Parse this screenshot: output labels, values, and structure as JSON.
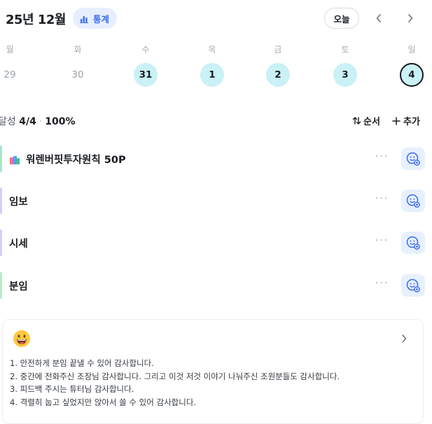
{
  "header": {
    "month_title": "25년 12월",
    "stats_label": "통계",
    "today_label": "오늘",
    "prev_icon": "chevron-left-icon",
    "next_icon": "chevron-right-icon"
  },
  "week": {
    "weekdays": [
      "월",
      "화",
      "수",
      "목",
      "금",
      "토",
      "일"
    ],
    "dates": [
      {
        "day": "29",
        "state": "plain"
      },
      {
        "day": "30",
        "state": "plain"
      },
      {
        "day": "31",
        "state": "done"
      },
      {
        "day": "1",
        "state": "done"
      },
      {
        "day": "2",
        "state": "done"
      },
      {
        "day": "3",
        "state": "done"
      },
      {
        "day": "4",
        "state": "selected"
      }
    ]
  },
  "progress": {
    "label": "달성",
    "count": "4/4",
    "percent": "100%",
    "sort_label": "순서",
    "add_label": "추가"
  },
  "tasks": [
    {
      "label": "워렌버핏투자원칙 50P",
      "icon": "books-icon",
      "color": "#a8e6c7"
    },
    {
      "label": "임보",
      "icon": "",
      "color": "#d4cdf7"
    },
    {
      "label": "시세",
      "icon": "",
      "color": "#d4cdf7"
    },
    {
      "label": "분임",
      "icon": "",
      "color": "#b7ecc4"
    }
  ],
  "memo": {
    "emoji": "grinning-face-icon",
    "lines": [
      "1. 안전하게 분임 끝낼 수 있어 감사합니다.",
      "2. 중간에 전화주신 조장님 감사합니다. 그리고 이것 저것 이야기 나눠주신 조원분들도 감사합니다.",
      "3. 피드백 주시는 튜터님 감사합니다.",
      "4. 격렬히 눕고 싶었지만 앉아서 쓸 수 있어 감사합니다."
    ]
  },
  "colors": {
    "accent_blue": "#3a6cf0",
    "stats_bg": "#e7efff",
    "done_circle": "#c9f1f6",
    "reaction_bg": "#e7f0ff"
  }
}
